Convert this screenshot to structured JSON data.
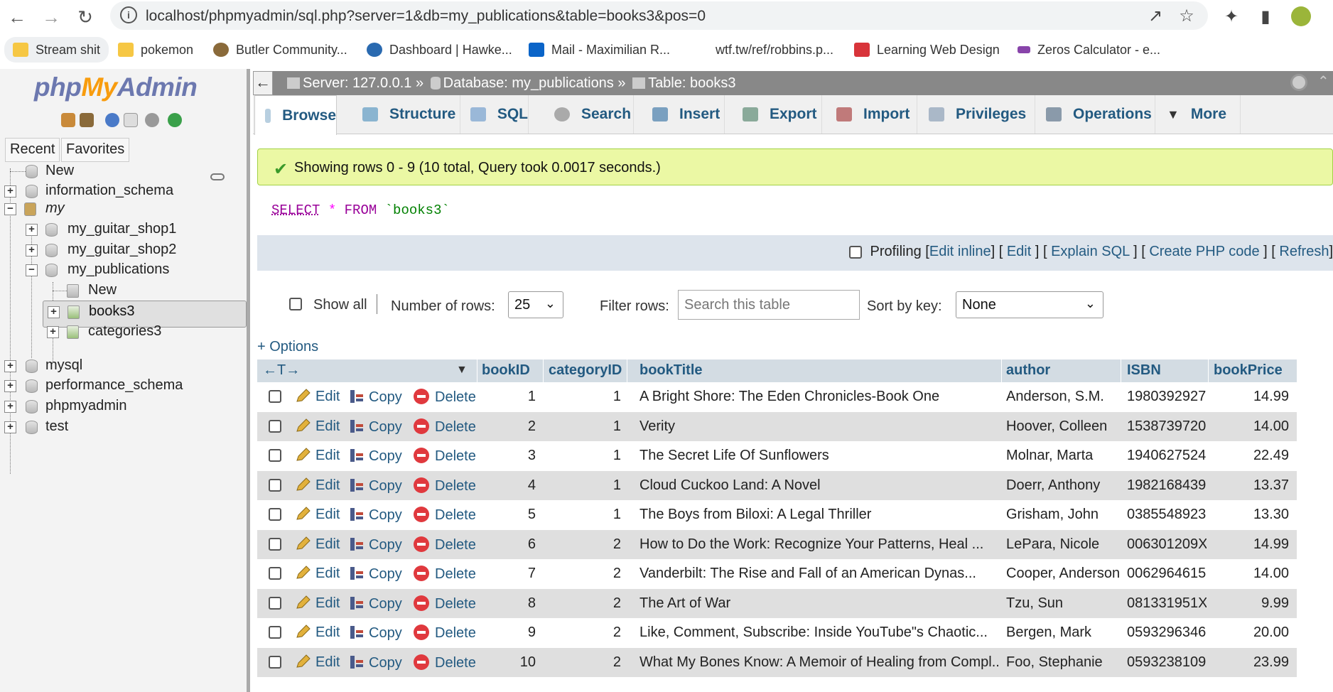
{
  "browser": {
    "url": "localhost/phpmyadmin/sql.php?server=1&db=my_publications&table=books3&pos=0",
    "bookmarks": [
      {
        "label": "Stream shit",
        "color": "#f6c744"
      },
      {
        "label": "pokemon",
        "color": "#f6c744"
      },
      {
        "label": "Butler Community...",
        "color": "#8a6a3a"
      },
      {
        "label": "Dashboard | Hawke...",
        "color": "#2a6ab0"
      },
      {
        "label": "Mail - Maximilian R...",
        "color": "#0a64c8"
      },
      {
        "label": "wtf.tw/ref/robbins.p...",
        "color": "#ffffff"
      },
      {
        "label": "Learning Web Design",
        "color": "#d8343a"
      },
      {
        "label": "Zeros Calculator - e...",
        "color": "#8844aa"
      }
    ]
  },
  "nav": {
    "logo_php": "php",
    "logo_my": "My",
    "logo_admin": "Admin",
    "tabs": {
      "recent": "Recent",
      "favorites": "Favorites"
    },
    "tree": {
      "new_root": "New",
      "information_schema": "information_schema",
      "my": "my",
      "my_guitar_shop1": "my_guitar_shop1",
      "my_guitar_shop2": "my_guitar_shop2",
      "my_publications": "my_publications",
      "new_table": "New",
      "books3": "books3",
      "categories3": "categories3",
      "mysql": "mysql",
      "performance_schema": "performance_schema",
      "phpmyadmin": "phpmyadmin",
      "test": "test"
    }
  },
  "breadcrumb": {
    "server": "Server: 127.0.0.1 »",
    "database": "Database: my_publications »",
    "table": "Table: books3"
  },
  "tabs": {
    "browse": "Browse",
    "structure": "Structure",
    "sql": "SQL",
    "search": "Search",
    "insert": "Insert",
    "export": "Export",
    "import": "Import",
    "privileges": "Privileges",
    "operations": "Operations",
    "more": "More"
  },
  "result": {
    "message": "Showing rows 0 - 9 (10 total, Query took 0.0017 seconds.)",
    "sql_select": "SELECT",
    "sql_star": "*",
    "sql_from": "FROM",
    "sql_table": "`books3`"
  },
  "sql_actions": {
    "profiling": "Profiling",
    "edit_inline": "Edit inline",
    "edit": "Edit",
    "explain": "Explain SQL",
    "create_php": "Create PHP code",
    "refresh": "Refresh"
  },
  "controls": {
    "show_all": "Show all",
    "num_rows_label": "Number of rows:",
    "num_rows_value": "25",
    "filter_label": "Filter rows:",
    "filter_placeholder": "Search this table",
    "sort_label": "Sort by key:",
    "sort_value": "None",
    "options": "+ Options"
  },
  "table": {
    "headers": {
      "bookID": "bookID",
      "categoryID": "categoryID",
      "bookTitle": "bookTitle",
      "author": "author",
      "isbn": "ISBN",
      "bookPrice": "bookPrice"
    },
    "actions": {
      "edit": "Edit",
      "copy": "Copy",
      "delete": "Delete"
    },
    "rows": [
      {
        "bookID": "1",
        "categoryID": "1",
        "bookTitle": "A Bright Shore: The Eden Chronicles-Book One",
        "author": "Anderson, S.M.",
        "isbn": "1980392927",
        "bookPrice": "14.99"
      },
      {
        "bookID": "2",
        "categoryID": "1",
        "bookTitle": "Verity",
        "author": "Hoover, Colleen",
        "isbn": "1538739720",
        "bookPrice": "14.00"
      },
      {
        "bookID": "3",
        "categoryID": "1",
        "bookTitle": "The Secret Life Of Sunflowers",
        "author": "Molnar, Marta",
        "isbn": "1940627524",
        "bookPrice": "22.49"
      },
      {
        "bookID": "4",
        "categoryID": "1",
        "bookTitle": "Cloud Cuckoo Land: A Novel",
        "author": "Doerr, Anthony",
        "isbn": "1982168439",
        "bookPrice": "13.37"
      },
      {
        "bookID": "5",
        "categoryID": "1",
        "bookTitle": "The Boys from Biloxi: A Legal Thriller",
        "author": "Grisham, John",
        "isbn": "0385548923",
        "bookPrice": "13.30"
      },
      {
        "bookID": "6",
        "categoryID": "2",
        "bookTitle": "How to Do the Work: Recognize Your Patterns, Heal ...",
        "author": "LePara, Nicole",
        "isbn": "006301209X",
        "bookPrice": "14.99"
      },
      {
        "bookID": "7",
        "categoryID": "2",
        "bookTitle": "Vanderbilt: The Rise and Fall of an American Dynas...",
        "author": "Cooper, Anderson",
        "isbn": "0062964615",
        "bookPrice": "14.00"
      },
      {
        "bookID": "8",
        "categoryID": "2",
        "bookTitle": "The Art of War",
        "author": "Tzu, Sun",
        "isbn": "081331951X",
        "bookPrice": "9.99"
      },
      {
        "bookID": "9",
        "categoryID": "2",
        "bookTitle": "Like, Comment, Subscribe: Inside YouTube\"s Chaotic...",
        "author": "Bergen, Mark",
        "isbn": "0593296346",
        "bookPrice": "20.00"
      },
      {
        "bookID": "10",
        "categoryID": "2",
        "bookTitle": "What My Bones Know: A Memoir of Healing from Compl...",
        "author": "Foo, Stephanie",
        "isbn": "0593238109",
        "bookPrice": "23.99"
      }
    ]
  },
  "colors": {
    "link": "#235a81",
    "success_bg": "#ebf8a4",
    "row_alt": "#dfdfdf",
    "header_bg": "#d3dce3"
  }
}
